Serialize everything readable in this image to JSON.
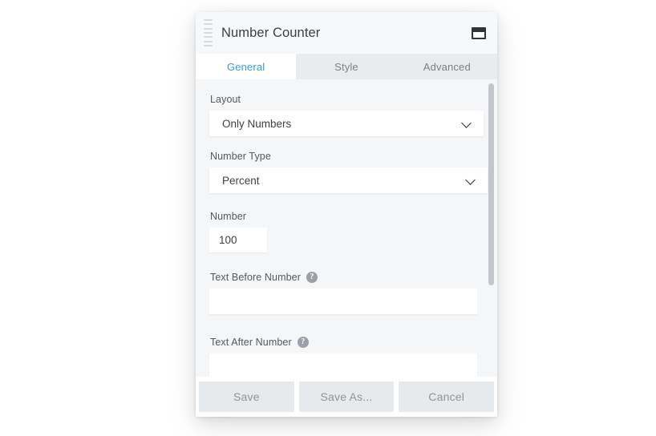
{
  "window": {
    "title": "Number Counter",
    "drag_handle_name": "drag-handle",
    "restore_icon": "window-icon"
  },
  "tabs": [
    {
      "label": "General",
      "active": true
    },
    {
      "label": "Style",
      "active": false
    },
    {
      "label": "Advanced",
      "active": false
    }
  ],
  "form": {
    "layout": {
      "label": "Layout",
      "value": "Only Numbers"
    },
    "number_type": {
      "label": "Number Type",
      "value": "Percent"
    },
    "number": {
      "label": "Number",
      "value": "100"
    },
    "text_before": {
      "label": "Text Before Number",
      "value": "",
      "placeholder": "",
      "help": "?"
    },
    "text_after": {
      "label": "Text After Number",
      "value": "",
      "placeholder": "",
      "help": "?"
    }
  },
  "footer": {
    "save": "Save",
    "save_as": "Save As...",
    "cancel": "Cancel"
  },
  "colors": {
    "accent": "#3a9ed4",
    "panel_bg": "#ffffff",
    "content_bg": "#f5f6f8",
    "tabbar_bg": "#e9ebee",
    "button_bg": "#e7eaec",
    "button_text": "#8f959b",
    "scrollbar_thumb": "#c3c7cc",
    "title_text": "#3b4045"
  }
}
